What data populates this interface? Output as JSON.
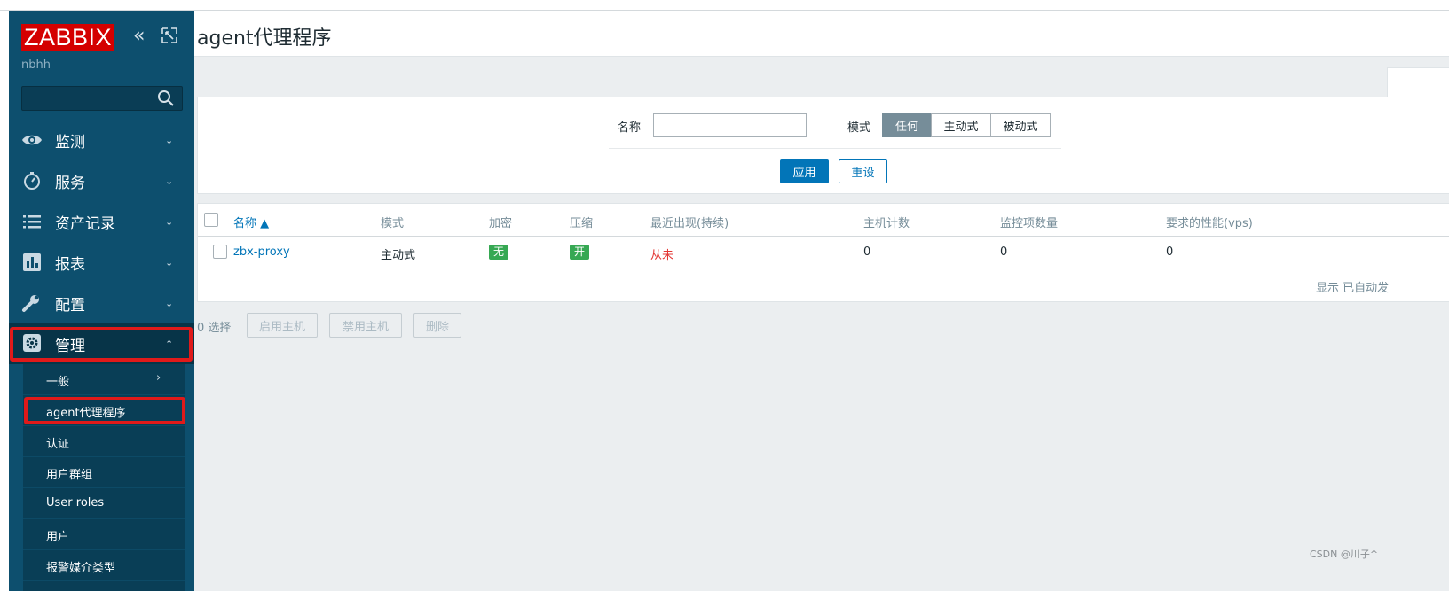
{
  "sidebar": {
    "logo": "ZABBIX",
    "server_name": "nbhh",
    "search_placeholder": "",
    "menu": [
      {
        "label": "监测"
      },
      {
        "label": "服务"
      },
      {
        "label": "资产记录"
      },
      {
        "label": "报表"
      },
      {
        "label": "配置"
      },
      {
        "label": "管理"
      }
    ],
    "submenu": [
      {
        "label": "一般"
      },
      {
        "label": "agent代理程序"
      },
      {
        "label": "认证"
      },
      {
        "label": "用户群组"
      },
      {
        "label": "User roles"
      },
      {
        "label": "用户"
      },
      {
        "label": "报警媒介类型"
      }
    ]
  },
  "header": {
    "title": "agent代理程序"
  },
  "filter": {
    "name_label": "名称",
    "name_value": "",
    "mode_label": "模式",
    "modes": [
      "任何",
      "主动式",
      "被动式"
    ],
    "selected_mode": "任何",
    "apply_label": "应用",
    "reset_label": "重设"
  },
  "table": {
    "columns": [
      "名称 ▲",
      "模式",
      "加密",
      "压缩",
      "最近出现(持续)",
      "主机计数",
      "监控项数量",
      "要求的性能(vps)"
    ],
    "rows": [
      {
        "name": "zbx-proxy",
        "mode": "主动式",
        "encryption": "无",
        "compression": "开",
        "last_seen": "从未",
        "hosts": "0",
        "items": "0",
        "nvps": "0"
      }
    ],
    "footer": "显示 已自动发"
  },
  "actions": {
    "selected": "0 选择",
    "enable": "启用主机",
    "disable": "禁用主机",
    "delete": "删除"
  },
  "watermark": "CSDN @川子^",
  "colors": {
    "sidebar": "#0d4f6e",
    "accent": "#0275b8",
    "logo": "#d40000",
    "badge_green": "#36a853",
    "never_red": "#e33734",
    "highlight": "#e01a1a"
  }
}
